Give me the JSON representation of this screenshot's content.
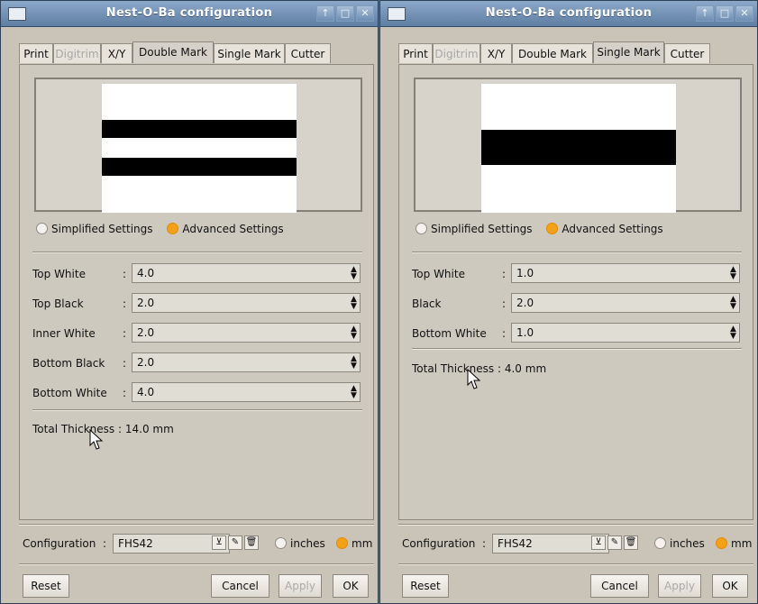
{
  "windows": [
    {
      "title": "Nest-O-Ba configuration",
      "tabs": [
        {
          "label": "Print",
          "state": "normal"
        },
        {
          "label": "Digitrim",
          "state": "disabled"
        },
        {
          "label": "X/Y",
          "state": "normal"
        },
        {
          "label": "Double Mark",
          "state": "active"
        },
        {
          "label": "Single Mark",
          "state": "normal"
        },
        {
          "label": "Cutter",
          "state": "normal"
        }
      ],
      "settings_mode": {
        "simplified": "Simplified Settings",
        "advanced": "Advanced Settings",
        "selected": "advanced"
      },
      "fields": [
        {
          "label": "Top White",
          "value": "4.0"
        },
        {
          "label": "Top Black",
          "value": "2.0"
        },
        {
          "label": "Inner White",
          "value": "2.0"
        },
        {
          "label": "Bottom Black",
          "value": "2.0"
        },
        {
          "label": "Bottom White",
          "value": "4.0"
        }
      ],
      "total": {
        "label": "Total Thickness",
        "value": "14.0 mm"
      },
      "configuration": {
        "label": "Configuration",
        "value": "FHS42"
      },
      "units": {
        "inches": "inches",
        "mm": "mm",
        "selected": "mm"
      },
      "buttons": {
        "reset": "Reset",
        "cancel": "Cancel",
        "apply": "Apply",
        "ok": "OK"
      },
      "apply_enabled": false
    },
    {
      "title": "Nest-O-Ba configuration",
      "tabs": [
        {
          "label": "Print",
          "state": "normal"
        },
        {
          "label": "Digitrim",
          "state": "disabled"
        },
        {
          "label": "X/Y",
          "state": "normal"
        },
        {
          "label": "Double Mark",
          "state": "normal"
        },
        {
          "label": "Single Mark",
          "state": "active"
        },
        {
          "label": "Cutter",
          "state": "normal"
        }
      ],
      "settings_mode": {
        "simplified": "Simplified Settings",
        "advanced": "Advanced Settings",
        "selected": "advanced"
      },
      "fields": [
        {
          "label": "Top White",
          "value": "1.0"
        },
        {
          "label": "Black",
          "value": "2.0"
        },
        {
          "label": "Bottom White",
          "value": "1.0"
        }
      ],
      "total": {
        "label": "Total Thickness",
        "value": "4.0 mm"
      },
      "configuration": {
        "label": "Configuration",
        "value": "FHS42"
      },
      "units": {
        "inches": "inches",
        "mm": "mm",
        "selected": "mm"
      },
      "buttons": {
        "reset": "Reset",
        "cancel": "Cancel",
        "apply": "Apply",
        "ok": "OK"
      },
      "apply_enabled": false
    }
  ],
  "colors": {
    "accent": "#f3a119",
    "title_bar": "#6f8db1",
    "mark": "#000000",
    "background": "#ffffff"
  }
}
